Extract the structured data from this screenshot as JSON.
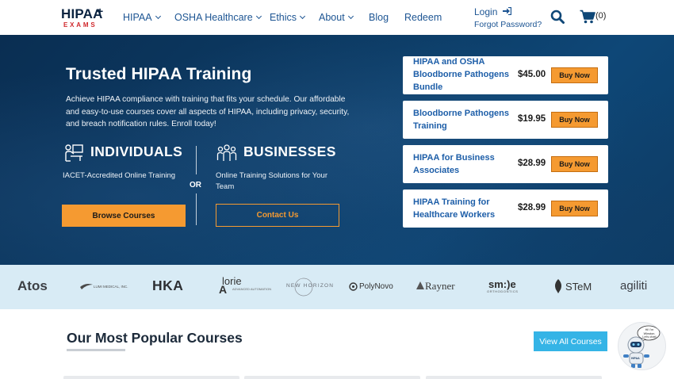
{
  "brand": {
    "logo_main": "HIPAA",
    "logo_plus": "+",
    "logo_sub": "EXAMS"
  },
  "nav": {
    "items": [
      {
        "label": "HIPAA",
        "dropdown": true
      },
      {
        "label": "OSHA Healthcare",
        "dropdown": true
      },
      {
        "label": "Ethics",
        "dropdown": true
      },
      {
        "label": "About",
        "dropdown": true
      },
      {
        "label": "Blog",
        "dropdown": false
      },
      {
        "label": "Redeem",
        "dropdown": false
      }
    ],
    "login": "Login",
    "forgot": "Forgot Password?",
    "cart_count": "(0)"
  },
  "hero": {
    "title": "Trusted HIPAA Training",
    "description": "Achieve HIPAA compliance with training that fits your schedule. Our affordable and easy-to-use courses cover all aspects of HIPAA, including privacy, security, and breach notification rules. Enroll today!",
    "individuals": {
      "title": "INDIVIDUALS",
      "desc": "IACET-Accredited Online Training",
      "button": "Browse Courses"
    },
    "or": "OR",
    "businesses": {
      "title": "BUSINESSES",
      "desc": "Online Training Solutions for Your Team",
      "button": "Contact Us"
    }
  },
  "courses": [
    {
      "name": "HIPAA and OSHA Bloodborne Pathogens Bundle",
      "price": "$45.00",
      "button": "Buy Now"
    },
    {
      "name": "Bloodborne Pathogens Training",
      "price": "$19.95",
      "button": "Buy Now"
    },
    {
      "name": "HIPAA for Business Associates",
      "price": "$28.99",
      "button": "Buy Now"
    },
    {
      "name": "HIPAA Training for Healthcare Workers",
      "price": "$28.99",
      "button": "Buy Now"
    }
  ],
  "clients": {
    "atos": "Atos",
    "lumi": "LUMI MEDICAL, INC.",
    "hka": "HKA",
    "lorie": "lorie",
    "lorie_sub": "ADVANCED AUTOMATION",
    "newhorizon": "NEW HORIZON",
    "polynovo": "PolyNovo",
    "rayner": "Rayner",
    "smile": "sm:)e",
    "smile_sub": "ORTHODONTICS",
    "stem": "STeM",
    "agiliti": "agiliti"
  },
  "popular": {
    "title": "Our Most Popular Courses",
    "view_all": "View All Courses"
  },
  "chatbot": {
    "bubble": "Hi! I'm Winston. Let's chat!",
    "badge": "HIPAA"
  },
  "colors": {
    "navy": "#0b3c66",
    "orange": "#f59a31",
    "link": "#1d5593",
    "cyan": "#35b4e6",
    "strip": "#d8ebf5"
  }
}
